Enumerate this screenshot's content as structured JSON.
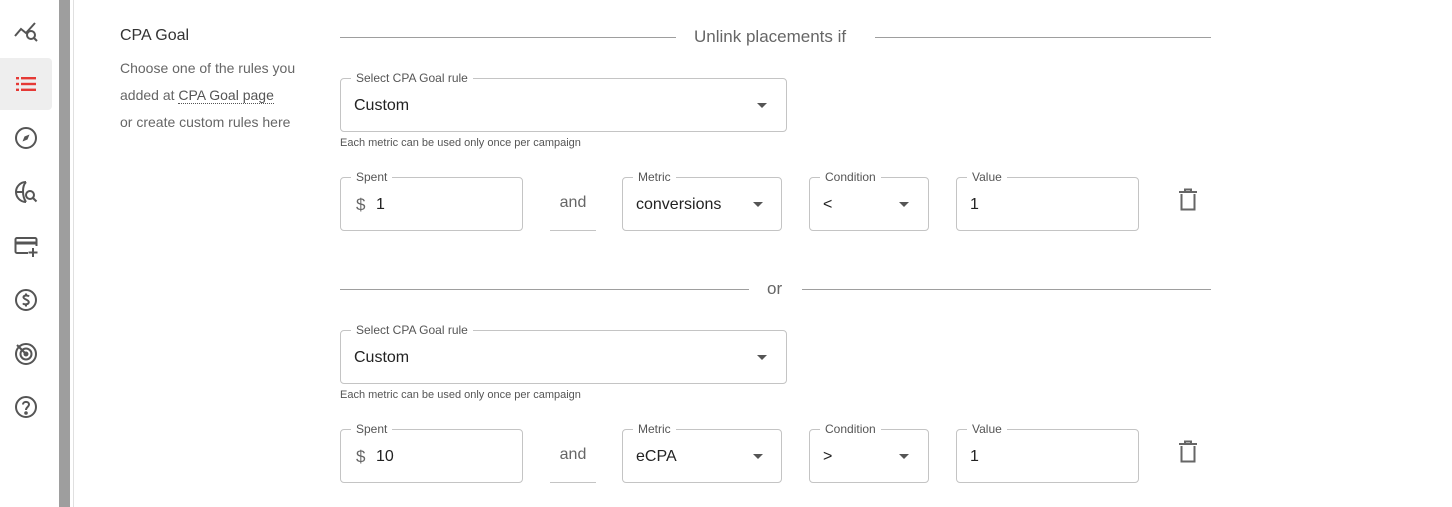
{
  "sidebar": {
    "items": [
      {
        "icon": "analytics-search-icon",
        "active": false
      },
      {
        "icon": "list-icon",
        "active": true
      },
      {
        "icon": "compass-icon",
        "active": false
      },
      {
        "icon": "globe-search-icon",
        "active": false
      },
      {
        "icon": "add-card-icon",
        "active": false
      },
      {
        "icon": "dollar-circle-icon",
        "active": false
      },
      {
        "icon": "target-icon",
        "active": false
      },
      {
        "icon": "help-icon",
        "active": false
      }
    ],
    "accent_color": "#e53935"
  },
  "section": {
    "title": "CPA Goal",
    "desc_line1": "Choose one of the rules you",
    "desc_line2_prefix": "added at",
    "desc_link": "CPA Goal page",
    "desc_line3": "or create custom rules here"
  },
  "header_separator": "Unlink placements if",
  "or_separator": "or",
  "rules": [
    {
      "rule_label": "Select CPA Goal rule",
      "rule_value": "Custom",
      "helper": "Each metric can be used only once per campaign",
      "spent_label": "Spent",
      "currency": "$",
      "spent_value": "1",
      "and_label": "and",
      "metric_label": "Metric",
      "metric_value": "conversions",
      "condition_label": "Condition",
      "condition_value": "<",
      "value_label": "Value",
      "value_value": "1"
    },
    {
      "rule_label": "Select CPA Goal rule",
      "rule_value": "Custom",
      "helper": "Each metric can be used only once per campaign",
      "spent_label": "Spent",
      "currency": "$",
      "spent_value": "10",
      "and_label": "and",
      "metric_label": "Metric",
      "metric_value": "eCPA",
      "condition_label": "Condition",
      "condition_value": ">",
      "value_label": "Value",
      "value_value": "1"
    }
  ]
}
